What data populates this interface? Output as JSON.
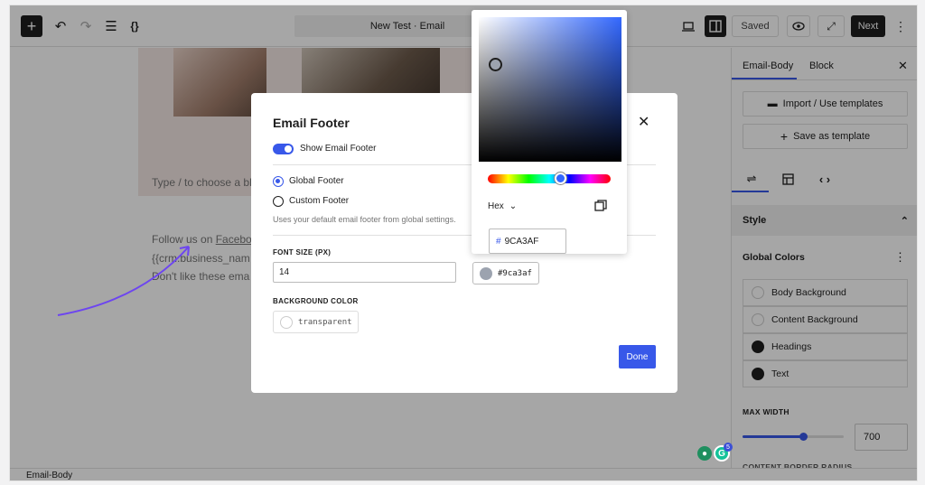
{
  "topbar": {
    "title": "New Test · Email",
    "saved_label": "Saved",
    "next_label": "Next"
  },
  "canvas": {
    "type_placeholder": "Type / to choose a bl",
    "follow_text": "Follow us on ",
    "follow_link": "Facebo",
    "business_var": "{{crm.business_nam",
    "unsubscribe_text": "Don't like these ema"
  },
  "sidebar": {
    "tabs": [
      "Email-Body",
      "Block"
    ],
    "import_label": "Import / Use templates",
    "save_template_label": "Save as template",
    "style_label": "Style",
    "global_colors_label": "Global Colors",
    "global_colors": [
      {
        "label": "Body Background",
        "color": "#ffffff"
      },
      {
        "label": "Content Background",
        "color": "#ffffff"
      },
      {
        "label": "Headings",
        "color": "#1e1e1e"
      },
      {
        "label": "Text",
        "color": "#1e1e1e"
      }
    ],
    "max_width_label": "MAX WIDTH",
    "max_width_value": "700",
    "max_width_fraction": 0.6,
    "next_section_label": "CONTENT BORDER RADIUS"
  },
  "modal": {
    "title": "Email Footer",
    "show_footer_label": "Show Email Footer",
    "global_footer_label": "Global Footer",
    "custom_footer_label": "Custom Footer",
    "help_text": "Uses your default email footer from global settings.",
    "font_size_label": "FONT SIZE (PX)",
    "font_size_value": "14",
    "text_color_value": "#9ca3af",
    "bg_color_label": "BACKGROUND COLOR",
    "bg_color_value": "transparent",
    "done_label": "Done"
  },
  "picker": {
    "format": "Hex",
    "hash": "#",
    "hex_value": "9CA3AF"
  },
  "statusbar": {
    "label": "Email-Body"
  },
  "badge_count": "5",
  "colors": {
    "accent": "#3858e9",
    "dark": "#1e1e1e",
    "arrow": "#6d45f0"
  }
}
